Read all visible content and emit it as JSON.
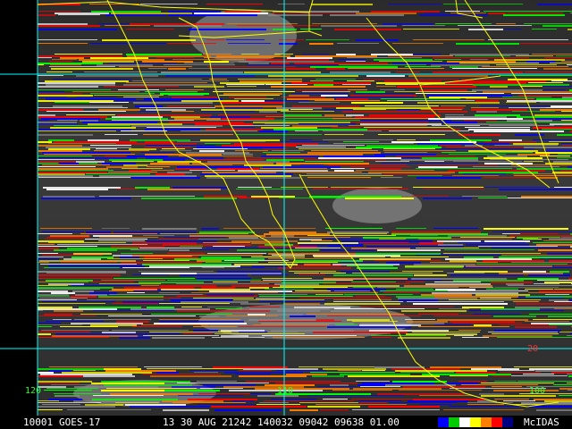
{
  "status": {
    "frame": "10001",
    "satellite": "GOES-17",
    "time_fields": "13 30 AUG 21242 140032 09042 09638 01.00",
    "brand": "McIDAS"
  },
  "labels": {
    "lat_20": "20",
    "lon_left": "120",
    "lon_mid": "110",
    "lon_right": "100"
  },
  "colors": {
    "map_outline": "#ffff00",
    "grid_line": "#00ffff",
    "lat_label": "#ff3030",
    "lon_label": "#30ff30"
  },
  "swatches": [
    "#0000ff",
    "#00cc00",
    "#ffffff",
    "#ffff00",
    "#ff8000",
    "#ff0000",
    "#000080"
  ]
}
